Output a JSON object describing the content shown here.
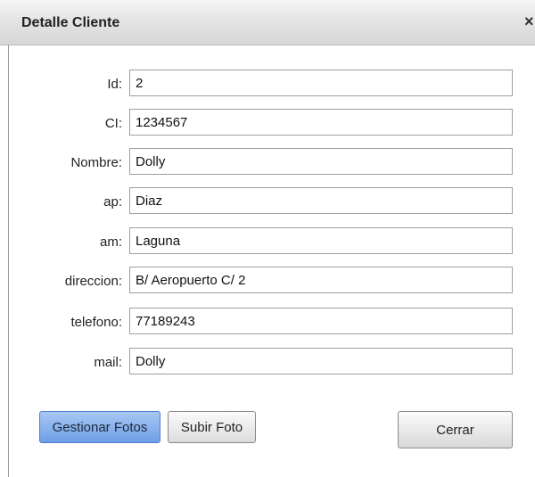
{
  "dialog": {
    "title": "Detalle Cliente",
    "close_label": "×"
  },
  "form": {
    "fields": [
      {
        "label": "Id:",
        "value": "2"
      },
      {
        "label": "CI:",
        "value": "1234567"
      },
      {
        "label": "Nombre:",
        "value": "Dolly"
      },
      {
        "label": "ap:",
        "value": "Diaz"
      },
      {
        "label": "am:",
        "value": "Laguna"
      },
      {
        "label": "direccion:",
        "value": "B/ Aeropuerto C/ 2"
      },
      {
        "label": "telefono:",
        "value": "77189243"
      },
      {
        "label": "mail:",
        "value": "Dolly"
      }
    ]
  },
  "buttons": {
    "gestionar_fotos": "Gestionar Fotos",
    "subir_foto": "Subir Foto",
    "cerrar": "Cerrar"
  },
  "colors": {
    "primary_button": "#6f9ee6",
    "titlebar": "#e2e2e2"
  }
}
